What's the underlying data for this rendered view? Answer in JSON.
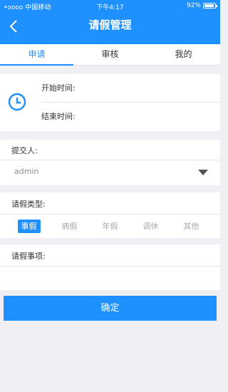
{
  "status": {
    "carrier": "•oooo 中国移动",
    "time": "下午4:17",
    "battery": "92%",
    "battery_level": 0.92
  },
  "header": {
    "title": "请假管理"
  },
  "tabs": [
    {
      "label": "申请"
    },
    {
      "label": "审核"
    },
    {
      "label": "我的"
    }
  ],
  "time": {
    "start_label": "开始时间:",
    "end_label": "结束时间:"
  },
  "submitter": {
    "label": "提交人:",
    "value": "admin"
  },
  "leave_type": {
    "label": "请假类型:",
    "options": [
      "事假",
      "病假",
      "年假",
      "调休",
      "其他"
    ],
    "selected": "事假"
  },
  "matter": {
    "label": "请假事项:"
  },
  "confirm_label": "确定"
}
